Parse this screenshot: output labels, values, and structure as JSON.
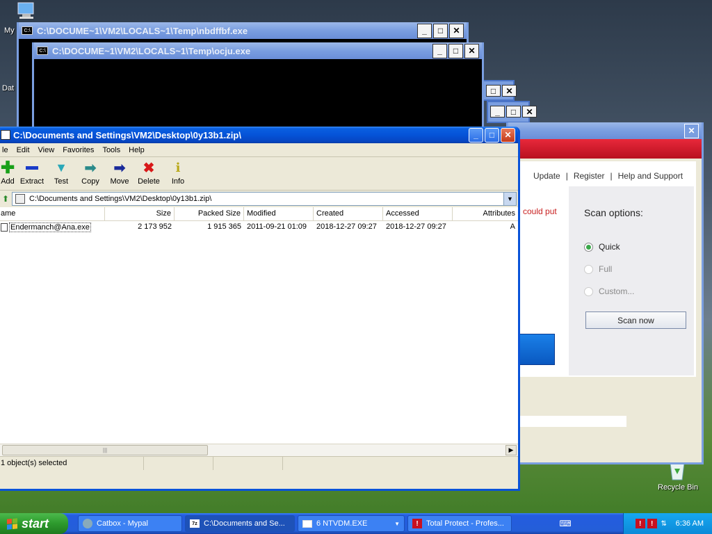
{
  "desktop": {
    "icons": [
      {
        "label": "My"
      },
      {
        "label": "Dat"
      },
      {
        "label": "Recycle Bin"
      }
    ]
  },
  "cmd1": {
    "title": "C:\\DOCUME~1\\VM2\\LOCALS~1\\Temp\\nbdffbf.exe"
  },
  "cmd2": {
    "title": "C:\\DOCUME~1\\VM2\\LOCALS~1\\Temp\\ocju.exe"
  },
  "av": {
    "links": [
      "Update",
      "Register",
      "Help and Support"
    ],
    "partial_text": "could put",
    "scan_options_title": "Scan options:",
    "options": [
      "Quick",
      "Full",
      "Custom..."
    ],
    "selected": "Quick",
    "scan_button": "Scan now"
  },
  "zip": {
    "title": "C:\\Documents and Settings\\VM2\\Desktop\\0y13b1.zip\\",
    "menu": [
      "le",
      "Edit",
      "View",
      "Favorites",
      "Tools",
      "Help"
    ],
    "toolbar": [
      {
        "label": "Add",
        "icon": "plus-icon",
        "color": "#18a018"
      },
      {
        "label": "Extract",
        "icon": "minus-icon",
        "color": "#1a3cc8"
      },
      {
        "label": "Test",
        "icon": "check-icon",
        "color": "#2aa8b8"
      },
      {
        "label": "Copy",
        "icon": "copy-arrow-icon",
        "color": "#2a8a8a"
      },
      {
        "label": "Move",
        "icon": "move-arrow-icon",
        "color": "#1a2a9a"
      },
      {
        "label": "Delete",
        "icon": "delete-x-icon",
        "color": "#d81818"
      },
      {
        "label": "Info",
        "icon": "info-icon",
        "color": "#b8a818"
      }
    ],
    "address": "C:\\Documents and Settings\\VM2\\Desktop\\0y13b1.zip\\",
    "columns": [
      "ame",
      "Size",
      "Packed Size",
      "Modified",
      "Created",
      "Accessed",
      "Attributes"
    ],
    "rows": [
      [
        "Endermanch@Ana.exe",
        "2 173 952",
        "1 915 365",
        "2011-09-21 01:09",
        "2018-12-27 09:27",
        "2018-12-27 09:27",
        "A"
      ]
    ],
    "status": "1 object(s) selected"
  },
  "taskbar": {
    "start": "start",
    "tasks": [
      {
        "label": "Catbox - Mypal",
        "active": false
      },
      {
        "label": "C:\\Documents and Se...",
        "active": true
      },
      {
        "label": "6  NTVDM.EXE",
        "active": false
      },
      {
        "label": "Total Protect - Profes...",
        "active": false
      }
    ],
    "clock": "6:36 AM"
  }
}
